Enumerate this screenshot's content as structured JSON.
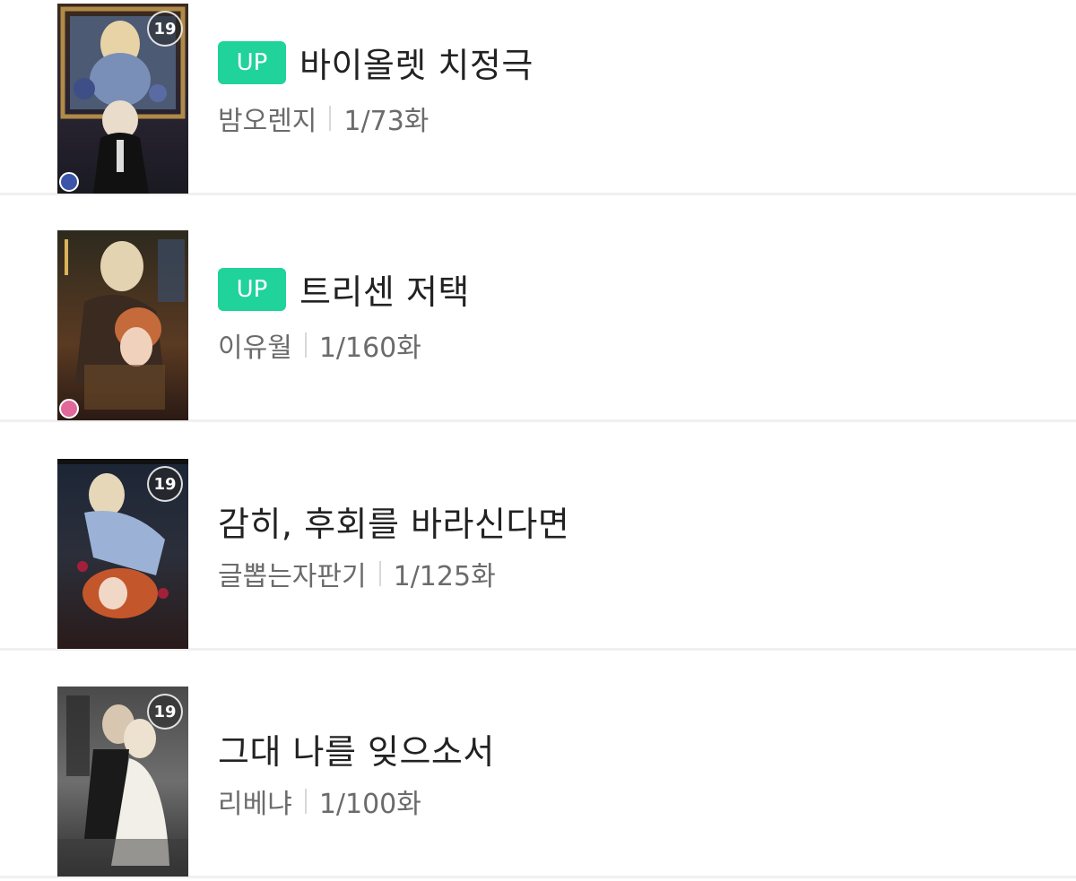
{
  "colors": {
    "up_badge": "#1fd39a",
    "title": "#222222",
    "meta": "#6b6b6b",
    "divider": "#d8d8d8"
  },
  "items": [
    {
      "badge": "UP",
      "title": "바이올렛 치정극",
      "author": "밤오렌지",
      "progress": "1/73화",
      "age_rating": "19",
      "cover_icon": "book-cover-violet"
    },
    {
      "badge": "UP",
      "title": "트리센 저택",
      "author": "이유월",
      "progress": "1/160화",
      "age_rating": "",
      "cover_icon": "book-cover-tricen"
    },
    {
      "badge": "",
      "title": "감히, 후회를 바라신다면",
      "author": "글뽑는자판기",
      "progress": "1/125화",
      "age_rating": "19",
      "cover_icon": "book-cover-regret"
    },
    {
      "badge": "",
      "title": "그대 나를 잊으소서",
      "author": "리베냐",
      "progress": "1/100화",
      "age_rating": "19",
      "cover_icon": "book-cover-forget"
    }
  ]
}
